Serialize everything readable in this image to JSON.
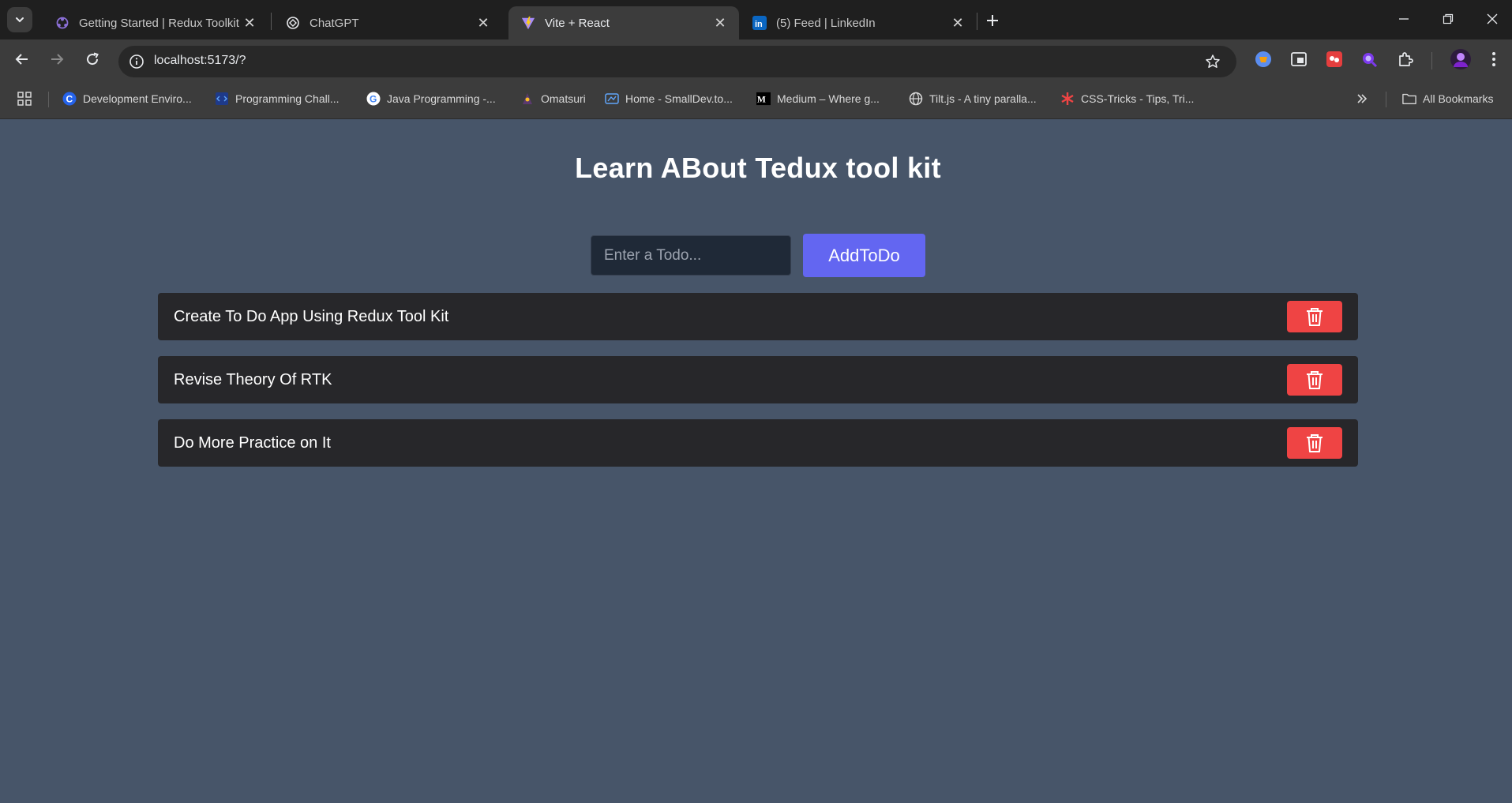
{
  "browser": {
    "tabs": [
      {
        "title": "Getting Started | Redux Toolkit",
        "favicon": "redux-icon",
        "active": false
      },
      {
        "title": "ChatGPT",
        "favicon": "chatgpt-icon",
        "active": false
      },
      {
        "title": "Vite + React",
        "favicon": "vite-icon",
        "active": true
      },
      {
        "title": "(5) Feed | LinkedIn",
        "favicon": "linkedin-icon",
        "active": false
      }
    ],
    "address": "localhost:5173/?",
    "bookmarks": [
      {
        "label": "Development Enviro...",
        "favicon": "c-icon"
      },
      {
        "label": "Programming Chall...",
        "favicon": "code-icon"
      },
      {
        "label": "Java Programming -...",
        "favicon": "google-icon"
      },
      {
        "label": "Omatsuri",
        "favicon": "omatsuri-icon"
      },
      {
        "label": "Home - SmallDev.to...",
        "favicon": "smalldev-icon"
      },
      {
        "label": "Medium – Where g...",
        "favicon": "medium-icon"
      },
      {
        "label": "Tilt.js - A tiny paralla...",
        "favicon": "globe-icon"
      },
      {
        "label": "CSS-Tricks - Tips, Tri...",
        "favicon": "asterisk-icon"
      }
    ],
    "all_bookmarks_label": "All Bookmarks"
  },
  "app": {
    "title": "Learn ABout Tedux tool kit",
    "input": {
      "placeholder": "Enter a Todo...",
      "value": ""
    },
    "add_button_label": "AddToDo",
    "todos": [
      {
        "text": "Create To Do App Using Redux Tool Kit"
      },
      {
        "text": "Revise Theory Of RTK"
      },
      {
        "text": "Do More Practice on It"
      }
    ]
  },
  "colors": {
    "page_bg": "#475569",
    "todo_bg": "#27272a",
    "add_button": "#6366f1",
    "delete_button": "#ef4444",
    "input_bg": "#1f2937"
  }
}
